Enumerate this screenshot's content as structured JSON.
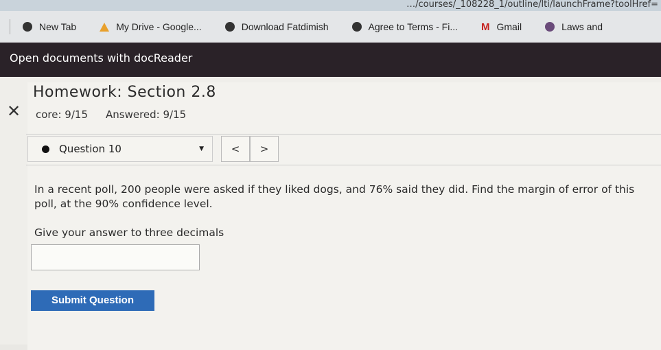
{
  "browser": {
    "url": "…/courses/_108228_1/outline/lti/launchFrame?toolHref=",
    "bookmarks": [
      {
        "label": "New Tab",
        "icon": "globe-icon"
      },
      {
        "label": "My Drive - Google...",
        "icon": "drive-icon"
      },
      {
        "label": "Download Fatdimish",
        "icon": "globe-icon"
      },
      {
        "label": "Agree to Terms - Fi...",
        "icon": "globe-icon"
      },
      {
        "label": "Gmail",
        "icon": "gmail-icon"
      },
      {
        "label": "Laws and",
        "icon": "site-icon"
      }
    ]
  },
  "banner": {
    "text": "Open documents with docReader"
  },
  "assignment": {
    "title": "Homework: Section 2.8",
    "score": "core: 9/15",
    "answered": "Answered: 9/15"
  },
  "question_nav": {
    "selected": "Question 10",
    "prev": "<",
    "next": ">"
  },
  "question": {
    "text": "In a recent poll, 200 people were asked if they liked dogs, and 76% said they did. Find the margin of error of this poll, at the 90% confidence level.",
    "instruction": "Give your answer to three decimals",
    "answer_value": "",
    "submit_label": "Submit Question"
  },
  "colors": {
    "submit": "#2e6bb7",
    "banner": "#2a2228"
  }
}
